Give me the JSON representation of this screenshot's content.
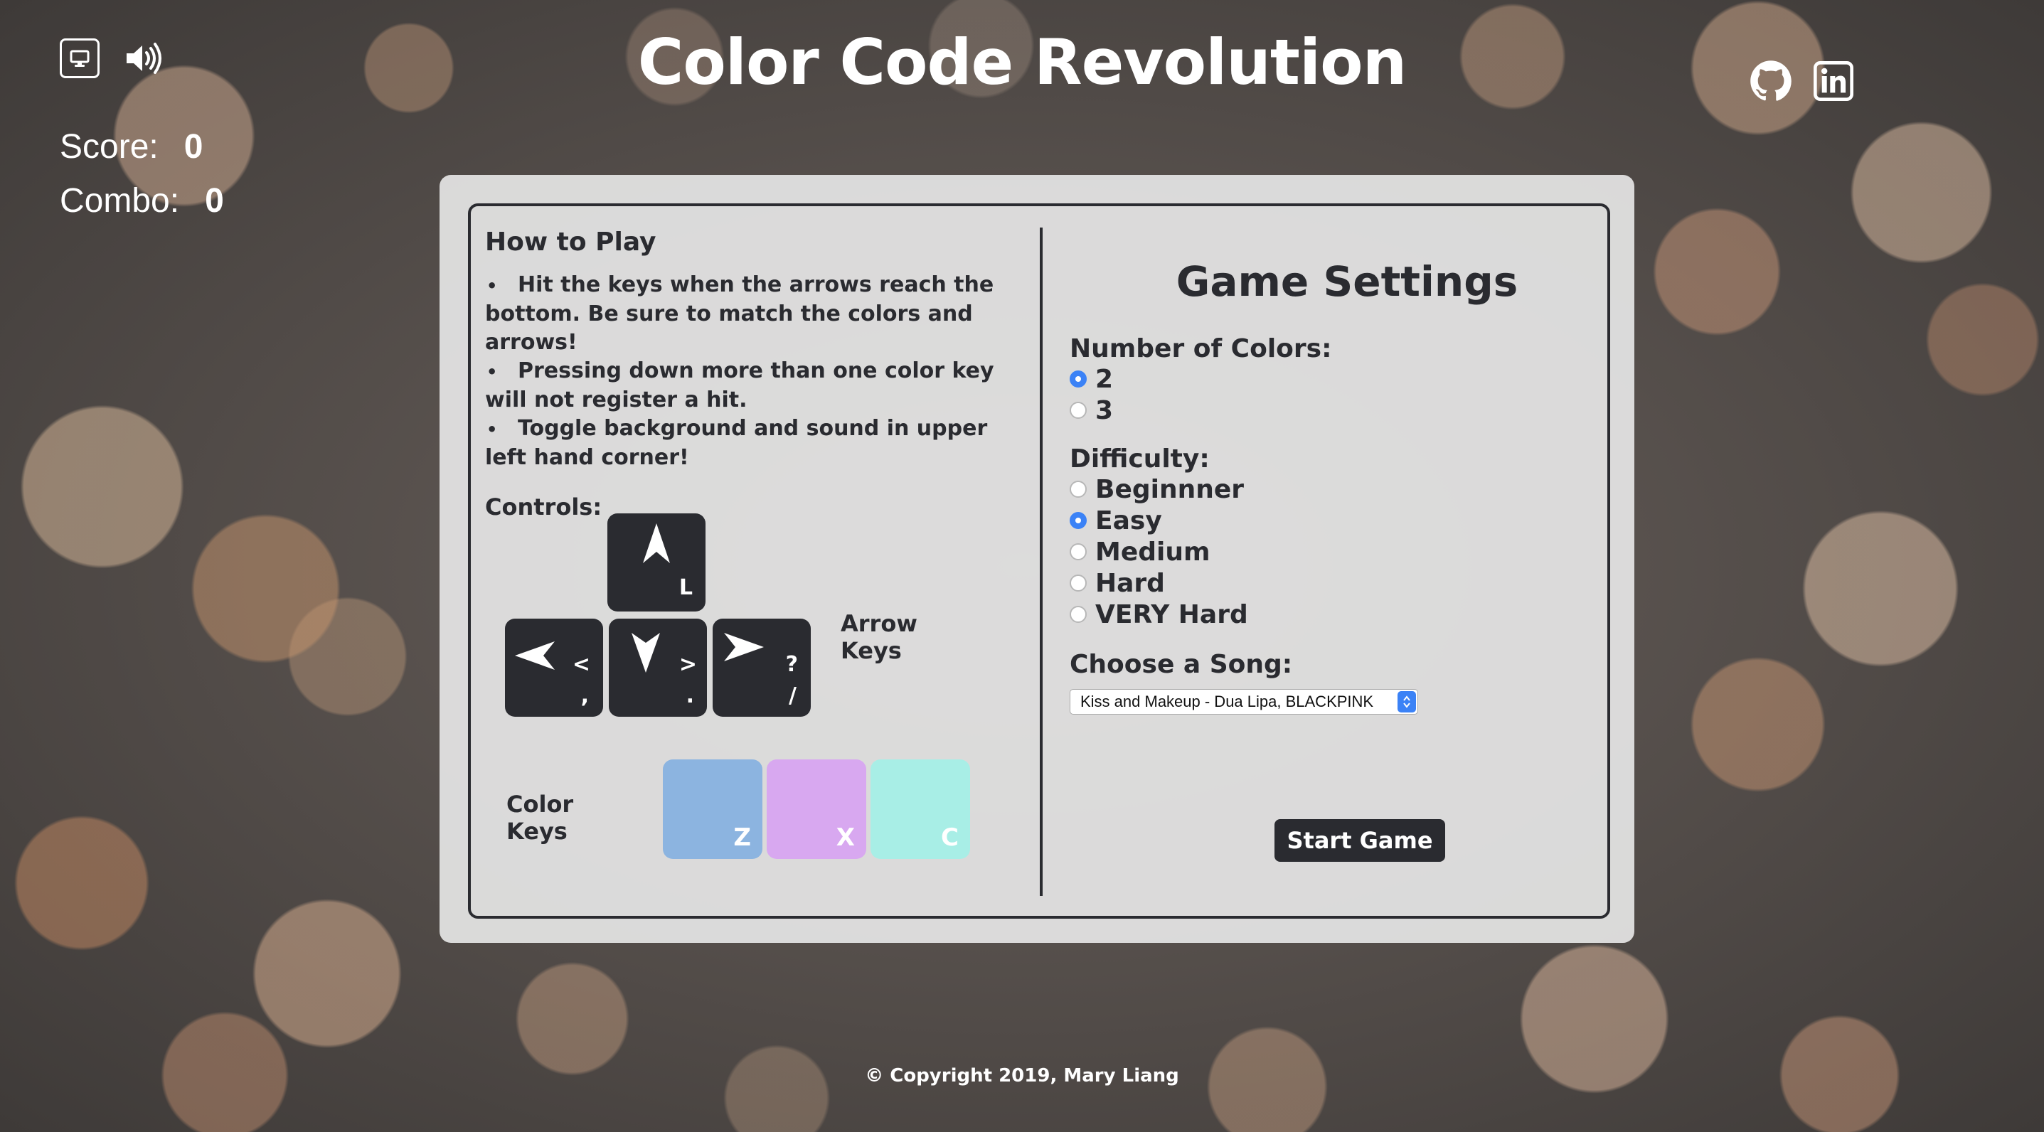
{
  "header": {
    "title": "Color Code Revolution",
    "icons": [
      "monitor-icon",
      "speaker-icon"
    ],
    "social": [
      "github-icon",
      "linkedin-icon"
    ]
  },
  "stats": {
    "score_label": "Score:",
    "score_value": "0",
    "combo_label": "Combo:",
    "combo_value": "0"
  },
  "howto": {
    "title": "How to Play",
    "rules": [
      "Hit the keys when the arrows reach the bottom. Be sure to match the colors and arrows!",
      "Pressing down more than one color key will not register a hit.",
      "Toggle background and sound in upper left hand corner!"
    ],
    "controls_label": "Controls:",
    "arrow_keys": {
      "label": "Arrow Keys",
      "up": {
        "chars": [
          "L"
        ]
      },
      "left": {
        "chars": [
          "<",
          ","
        ]
      },
      "down": {
        "chars": [
          ">",
          "."
        ]
      },
      "right": {
        "chars": [
          "?",
          "/"
        ]
      }
    },
    "color_keys": {
      "label": "Color Keys",
      "keys": [
        {
          "char": "Z",
          "color": "#8cb4e0"
        },
        {
          "char": "X",
          "color": "#d8a8f0"
        },
        {
          "char": "C",
          "color": "#a8eee6"
        }
      ]
    }
  },
  "settings": {
    "title": "Game Settings",
    "colors_label": "Number of Colors:",
    "colors_options": [
      {
        "label": "2",
        "checked": true
      },
      {
        "label": "3",
        "checked": false
      }
    ],
    "difficulty_label": "Difficulty:",
    "difficulty_options": [
      {
        "label": "Beginnner",
        "checked": false
      },
      {
        "label": "Easy",
        "checked": true
      },
      {
        "label": "Medium",
        "checked": false
      },
      {
        "label": "Hard",
        "checked": false
      },
      {
        "label": "VERY Hard",
        "checked": false
      }
    ],
    "song_label": "Choose a Song:",
    "song_selected": "Kiss and Makeup - Dua Lipa, BLACKPINK",
    "start_label": "Start Game"
  },
  "footer": {
    "copyright": "© Copyright 2019, Mary Liang"
  },
  "colors": {
    "dark": "#2a2b30",
    "accent": "#3b82f6"
  }
}
